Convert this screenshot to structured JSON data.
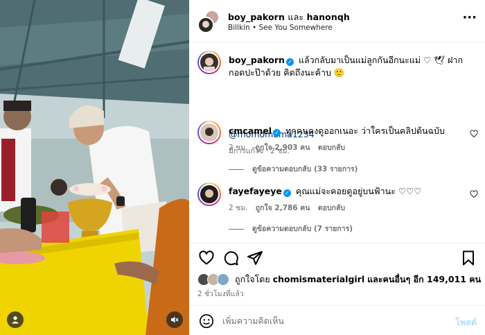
{
  "post": {
    "header": {
      "names": "boy_pakorn",
      "and_word": "และ",
      "second_name": "hanonqh",
      "music_artist": "Billkin",
      "music_sep": "•",
      "music_song": "See You Somewhere",
      "more_icon": "more-horizontal-icon"
    },
    "caption": {
      "username": "boy_pakorn",
      "text": "แล้วกลับมาเป็นแม่ลูกกันอีกนะแม่ ♡ 🕊 ฝากกอดปะป๊าด้วย คิดถึงนะค้าบ 🙂",
      "mention": "@momomama1234",
      "meta": "มีการแก้ไข · 2 ชม."
    },
    "comments": [
      {
        "username": "cmcamel",
        "text": "ทุกคนคงดูออกเนอะ ว่าใครเป็นคลิปต้นฉบับ",
        "time": "2 ชม.",
        "likes": "ถูกใจ 2,903 คน",
        "reply": "ตอบกลับ",
        "view_replies": "ดูข้อความตอบกลับ (33 รายการ)"
      },
      {
        "username": "fayefayeye",
        "text": "คุณแม่จะคอยดูอยู่บนฟ้านะ ♡♡♡",
        "time": "2 ชม.",
        "likes": "ถูกใจ 2,786 คน",
        "reply": "ตอบกลับ",
        "view_replies": "ดูข้อความตอบกลับ (7 รายการ)"
      }
    ],
    "likes": {
      "prefix": "ถูกใจโดย",
      "user": "chomismaterialgirl",
      "and_others": "และคนอื่นๆ อีก 149,011 คน"
    },
    "time_ago": "2 ชั่วโมงที่แล้ว",
    "add_comment": {
      "placeholder": "เพิ่มความคิดเห็น",
      "post_label": "โพสต์"
    }
  },
  "icons": {
    "like": "heart-icon",
    "comment": "comment-icon",
    "share": "send-icon",
    "save": "bookmark-icon",
    "emoji": "emoji-icon",
    "tag": "user-tag-icon",
    "mute": "speaker-muted-icon",
    "verified": "verified-badge-icon"
  },
  "colors": {
    "verified": "#0095f6",
    "link": "#00376b",
    "post_disabled": "#b2dffc",
    "secondary_text": "#737373"
  }
}
